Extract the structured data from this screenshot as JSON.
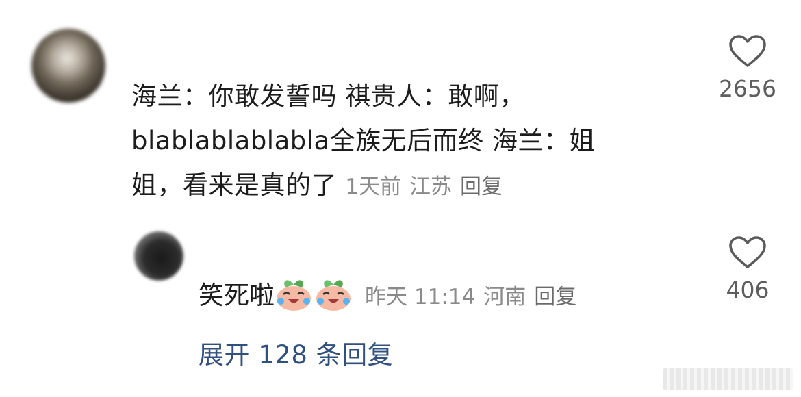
{
  "main_comment": {
    "username": "",
    "text": "海兰：你敢发誓吗 祺贵人：敢啊，blablablablabla全族无后而终 海兰：姐姐，看来是真的了",
    "time": "1天前",
    "location": "江苏",
    "reply_label": "回复",
    "like_count": "2656"
  },
  "reply_comment": {
    "username": "",
    "text": "笑死啦",
    "emoji_icons": [
      "laughing-crying-peach-emoji",
      "laughing-crying-peach-emoji"
    ],
    "time": "昨天 11:14",
    "location": "河南",
    "reply_label": "回复",
    "like_count": "406"
  },
  "expand_replies": "展开 128 条回复",
  "colors": {
    "link_blue": "#30507f",
    "meta_gray": "#8a8a8a",
    "text": "#1c1c1c"
  }
}
